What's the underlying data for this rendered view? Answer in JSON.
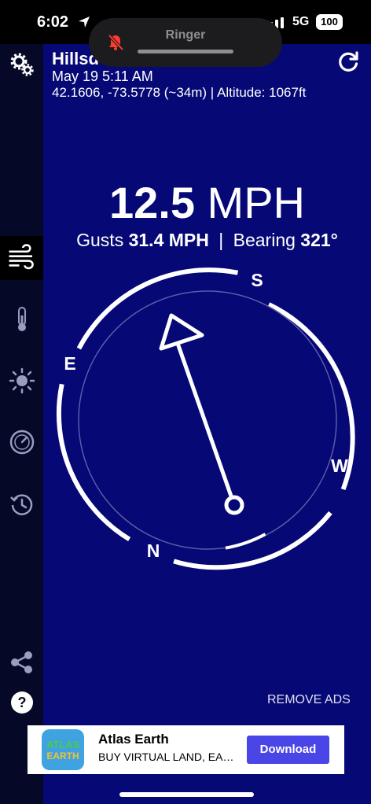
{
  "status_bar": {
    "time": "6:02",
    "network": "5G",
    "battery": "100"
  },
  "ringer": {
    "label": "Ringer"
  },
  "location": {
    "name": "Hillsd",
    "date": "May 19 5:11 AM",
    "coords": "42.1606, -73.5778 (~34m) | Altitude: 1067ft"
  },
  "wind": {
    "speed": "12.5",
    "speed_unit": "MPH",
    "gusts_label": "Gusts",
    "gusts": "31.4 MPH",
    "separator": "|",
    "bearing_label": "Bearing",
    "bearing": "321°"
  },
  "compass": {
    "north": "N",
    "east": "E",
    "south": "S",
    "west": "W"
  },
  "sidebar": {
    "items": [
      {
        "icon": "settings-icon"
      },
      {
        "icon": "wind-icon",
        "active": true
      },
      {
        "icon": "thermometer-icon"
      },
      {
        "icon": "sun-icon"
      },
      {
        "icon": "gauge-icon"
      },
      {
        "icon": "history-icon"
      },
      {
        "icon": "share-icon"
      },
      {
        "icon": "help-icon"
      }
    ]
  },
  "actions": {
    "remove_ads": "REMOVE ADS"
  },
  "ad": {
    "logo_top": "ATLAS",
    "logo_bottom": "EARTH",
    "title": "Atlas Earth",
    "subtitle": "BUY VIRTUAL LAND, EA…",
    "button": "Download"
  },
  "colors": {
    "background": "#050875",
    "sidebar": "#050826",
    "accent": "#4a45e6",
    "ringer_icon": "#ff3b30"
  }
}
